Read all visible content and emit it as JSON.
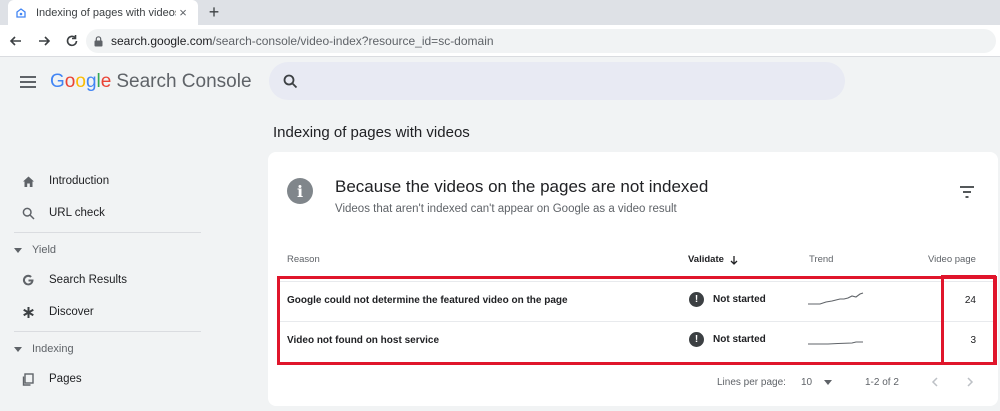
{
  "browser": {
    "tab_title": "Indexing of pages with videos",
    "url_host": "search.google.com",
    "url_path": "/search-console/video-index?resource_id=sc-domain"
  },
  "app": {
    "brand_google": [
      "G",
      "o",
      "o",
      "g",
      "l",
      "e"
    ],
    "brand_product": "Search Console"
  },
  "sidebar": {
    "items": [
      {
        "label": "Introduction",
        "icon": "home-icon"
      },
      {
        "label": "URL check",
        "icon": "search-icon"
      }
    ],
    "sections": [
      {
        "label": "Yield",
        "items": [
          {
            "label": "Search Results",
            "icon": "google-g-icon"
          },
          {
            "label": "Discover",
            "icon": "asterisk-icon"
          }
        ]
      },
      {
        "label": "Indexing",
        "items": [
          {
            "label": "Pages",
            "icon": "pages-icon"
          }
        ]
      }
    ]
  },
  "main": {
    "page_title": "Indexing of pages with videos",
    "card": {
      "title": "Because the videos on the pages are not indexed",
      "subtitle": "Videos that aren't indexed can't appear on Google as a video result"
    },
    "table": {
      "headers": {
        "reason": "Reason",
        "validate": "Validate",
        "trend": "Trend",
        "count": "Video page"
      },
      "rows": [
        {
          "reason": "Google could not determine the featured video on the page",
          "status": "Not started",
          "count": "24"
        },
        {
          "reason": "Video not found on host service",
          "status": "Not started",
          "count": "3"
        }
      ]
    },
    "pager": {
      "lines_label": "Lines per page:",
      "lines_value": "10",
      "range": "1-2 of 2"
    }
  },
  "colors": {
    "highlight": "#e0152b",
    "accent": "#4285f4"
  }
}
